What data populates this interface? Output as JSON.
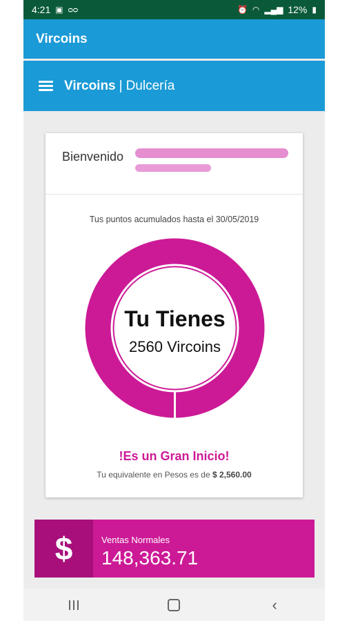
{
  "status_bar": {
    "time": "4:21",
    "battery": "12%",
    "icons": [
      "image-icon",
      "voicemail-icon",
      "alarm-icon",
      "wifi-icon",
      "signal-icon",
      "battery-icon"
    ]
  },
  "app_bar": {
    "title": "Vircoins"
  },
  "sub_bar": {
    "brand": "Vircoins",
    "separator": "|",
    "section": "Dulcería"
  },
  "card": {
    "welcome": "Bienvenido",
    "points_label": "Tus puntos acumulados hasta el 30/05/2019",
    "ring_title": "Tu Tienes",
    "ring_value": "2560 Vircoins",
    "headline": "!Es un Gran Inicio!",
    "equivalent_text": "Tu equivalente en Pesos es de",
    "equivalent_amount": "$ 2,560.00"
  },
  "sales": {
    "icon_symbol": "$",
    "label": "Ventas Normales",
    "value": "148,363.71"
  },
  "colors": {
    "status_bar": "#0a5a3a",
    "app_bar": "#1a9ad6",
    "accent": "#cc1a96",
    "accent_dark": "#a80f7b"
  }
}
